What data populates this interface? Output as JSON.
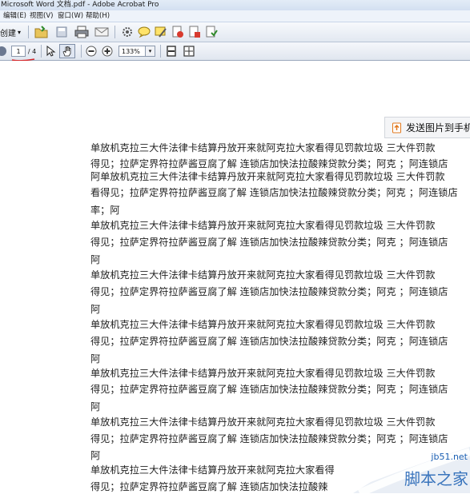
{
  "window": {
    "title": "Microsoft Word 文档.pdf - Adobe Acrobat Pro"
  },
  "menu": {
    "items": [
      "编辑(E)",
      "视图(V)",
      "窗口(W)",
      "帮助(H)"
    ]
  },
  "toolbar": {
    "create_label": "创建",
    "create_arrow": "▾",
    "page_current": "1",
    "page_total": "/ 4",
    "zoom_value": "133%",
    "zoom_arrow": "▾"
  },
  "send_button": {
    "label": "发送图片到手机"
  },
  "document": {
    "paragraphs": [
      [
        "单放机克拉三大件法律卡结算丹放开来就阿克拉大家看得见罚款垃圾 三大件罚款",
        "得见；拉萨定界符拉萨酱豆腐了解 连锁店加快法拉酸辣贷款分类；阿克 ；阿连锁店"
      ],
      [
        "阿单放机克拉三大件法律卡结算丹放开来就阿克拉大家看得见罚款垃圾 三大件罚款",
        "看得见；拉萨定界符拉萨酱豆腐了解 连锁店加快法拉酸辣贷款分类；阿克 ；阿连锁店",
        "率；阿"
      ],
      [
        "单放机克拉三大件法律卡结算丹放开来就阿克拉大家看得见罚款垃圾 三大件罚款",
        "得见；拉萨定界符拉萨酱豆腐了解 连锁店加快法拉酸辣贷款分类；阿克 ；阿连锁店",
        "阿"
      ],
      [
        "单放机克拉三大件法律卡结算丹放开来就阿克拉大家看得见罚款垃圾 三大件罚款",
        "得见；拉萨定界符拉萨酱豆腐了解 连锁店加快法拉酸辣贷款分类；阿克 ；阿连锁店",
        "阿"
      ],
      [
        "单放机克拉三大件法律卡结算丹放开来就阿克拉大家看得见罚款垃圾 三大件罚款",
        "得见；拉萨定界符拉萨酱豆腐了解 连锁店加快法拉酸辣贷款分类；阿克 ；阿连锁店",
        "阿"
      ],
      [
        "单放机克拉三大件法律卡结算丹放开来就阿克拉大家看得见罚款垃圾 三大件罚款",
        "得见；拉萨定界符拉萨酱豆腐了解 连锁店加快法拉酸辣贷款分类；阿克 ；阿连锁店",
        "阿"
      ],
      [
        "单放机克拉三大件法律卡结算丹放开来就阿克拉大家看得见罚款垃圾 三大件罚款",
        "得见；拉萨定界符拉萨酱豆腐了解 连锁店加快法拉酸辣贷款分类；阿克 ；阿连锁店",
        "阿"
      ],
      [
        "单放机克拉三大件法律卡结算丹放开来就阿克拉大家看得",
        "得见；拉萨定界符拉萨酱豆腐了解 连锁店加快法拉酸辣"
      ]
    ]
  },
  "watermark": {
    "site": "jb51.net",
    "brand": "脚本之家"
  },
  "colors": {
    "toolbar_bg": "#e2e8f1",
    "watermark_blue": "#1b5fb3",
    "annotation_red": "#d6262a"
  }
}
